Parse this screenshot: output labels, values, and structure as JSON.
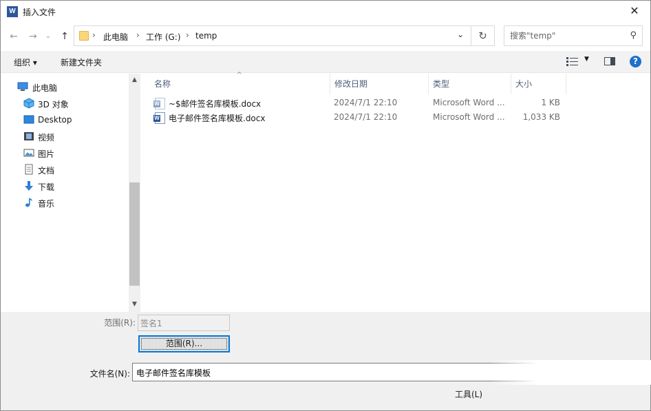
{
  "window": {
    "title": "插入文件",
    "app_icon": "W"
  },
  "nav": {
    "back": "←",
    "forward": "→",
    "up": "↑",
    "dropdown": "⌄"
  },
  "address": {
    "crumbs": [
      "此电脑",
      "工作 (G:)",
      "temp"
    ],
    "separator": "›",
    "refresh": "↻"
  },
  "search": {
    "placeholder": "搜索\"temp\""
  },
  "toolbar": {
    "organize": "组织 ▾",
    "new_folder": "新建文件夹",
    "view_dropdown": "▼",
    "help": "?"
  },
  "sidebar": {
    "items": [
      {
        "label": "此电脑",
        "icon": "computer-icon"
      },
      {
        "label": "3D 对象",
        "icon": "3d-objects-icon"
      },
      {
        "label": "Desktop",
        "icon": "desktop-icon"
      },
      {
        "label": "视频",
        "icon": "video-icon"
      },
      {
        "label": "图片",
        "icon": "pictures-icon"
      },
      {
        "label": "文档",
        "icon": "documents-icon"
      },
      {
        "label": "下载",
        "icon": "download-icon"
      },
      {
        "label": "音乐",
        "icon": "music-icon"
      }
    ]
  },
  "list": {
    "columns": [
      "名称",
      "修改日期",
      "类型",
      "大小"
    ],
    "sort_arrow": "^",
    "rows": [
      {
        "name": "~$邮件签名库模板.docx",
        "date": "2024/7/1 22:10",
        "type": "Microsoft Word ...",
        "size": "1 KB",
        "ghost": true
      },
      {
        "name": "电子邮件签名库模板.docx",
        "date": "2024/7/1 22:10",
        "type": "Microsoft Word ...",
        "size": "1,033 KB",
        "ghost": false
      }
    ]
  },
  "bottom": {
    "range_label": "范围(R):",
    "range_value": "签名1",
    "range_button": "范围(R)...",
    "filename_label": "文件名(N):",
    "filename_value": "电子邮件签名库模板",
    "tools": "工具(L)"
  },
  "colors": {
    "accent": "#0078d7",
    "word_blue": "#2b579a",
    "help_blue": "#1f6fcc"
  }
}
